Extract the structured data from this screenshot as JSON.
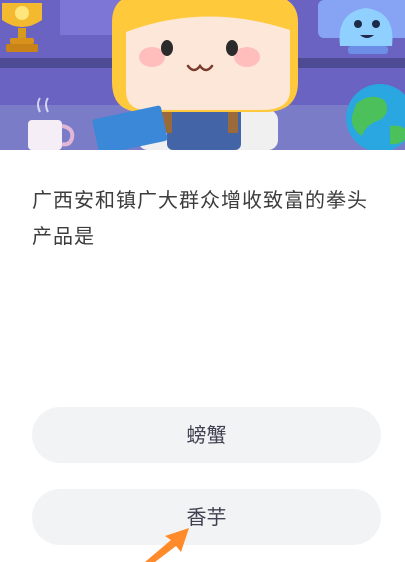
{
  "question": {
    "text": "广西安和镇广大群众增收致富的拳头产品是"
  },
  "options": [
    {
      "label": "螃蟹"
    },
    {
      "label": "香芋"
    }
  ],
  "colors": {
    "banner_purple": "#6a63c2",
    "option_bg": "#f2f3f5",
    "pointer_orange": "#ff8a2a"
  }
}
